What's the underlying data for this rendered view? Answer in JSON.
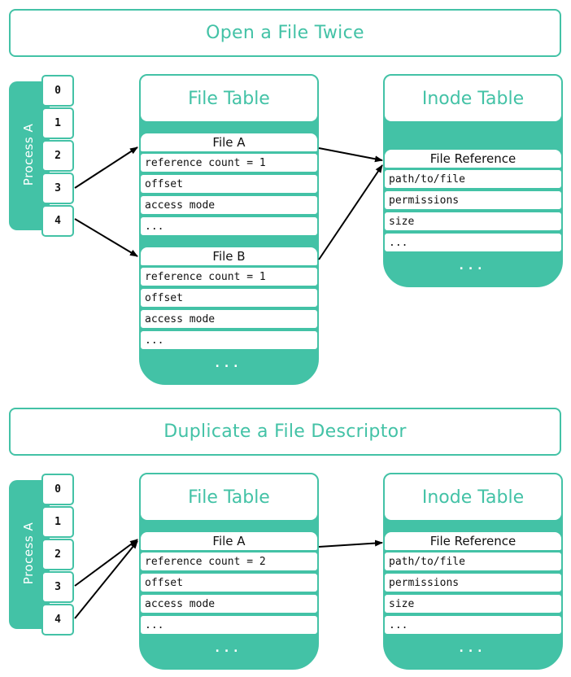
{
  "sections": [
    {
      "title": "Open a File Twice",
      "process": {
        "label": "Process A",
        "fds": [
          "0",
          "1",
          "2",
          "3",
          "4"
        ]
      },
      "file_table": {
        "title": "File Table",
        "entries": [
          {
            "name": "File A",
            "rows": [
              "reference count = 1",
              "offset",
              "access mode",
              "..."
            ]
          },
          {
            "name": "File B",
            "rows": [
              "reference count = 1",
              "offset",
              "access mode",
              "..."
            ]
          }
        ],
        "more": "..."
      },
      "inode_table": {
        "title": "Inode Table",
        "entries": [
          {
            "name": "File Reference",
            "rows": [
              "path/to/file",
              "permissions",
              "size",
              "..."
            ]
          }
        ],
        "more": "..."
      },
      "links": [
        {
          "from": "fd 3",
          "to": "File A"
        },
        {
          "from": "fd 4",
          "to": "File B"
        },
        {
          "from": "File A",
          "to": "File Reference"
        },
        {
          "from": "File B",
          "to": "File Reference"
        }
      ]
    },
    {
      "title": "Duplicate a File Descriptor",
      "process": {
        "label": "Process A",
        "fds": [
          "0",
          "1",
          "2",
          "3",
          "4"
        ]
      },
      "file_table": {
        "title": "File Table",
        "entries": [
          {
            "name": "File A",
            "rows": [
              "reference count = 2",
              "offset",
              "access mode",
              "..."
            ]
          }
        ],
        "more": "..."
      },
      "inode_table": {
        "title": "Inode Table",
        "entries": [
          {
            "name": "File Reference",
            "rows": [
              "path/to/file",
              "permissions",
              "size",
              "..."
            ]
          }
        ],
        "more": "..."
      },
      "links": [
        {
          "from": "fd 3",
          "to": "File A"
        },
        {
          "from": "fd 4",
          "to": "File A"
        },
        {
          "from": "File A",
          "to": "File Reference"
        }
      ]
    }
  ],
  "colors": {
    "accent": "#43c2a6",
    "arrow": "#000000",
    "text": "#111111"
  }
}
